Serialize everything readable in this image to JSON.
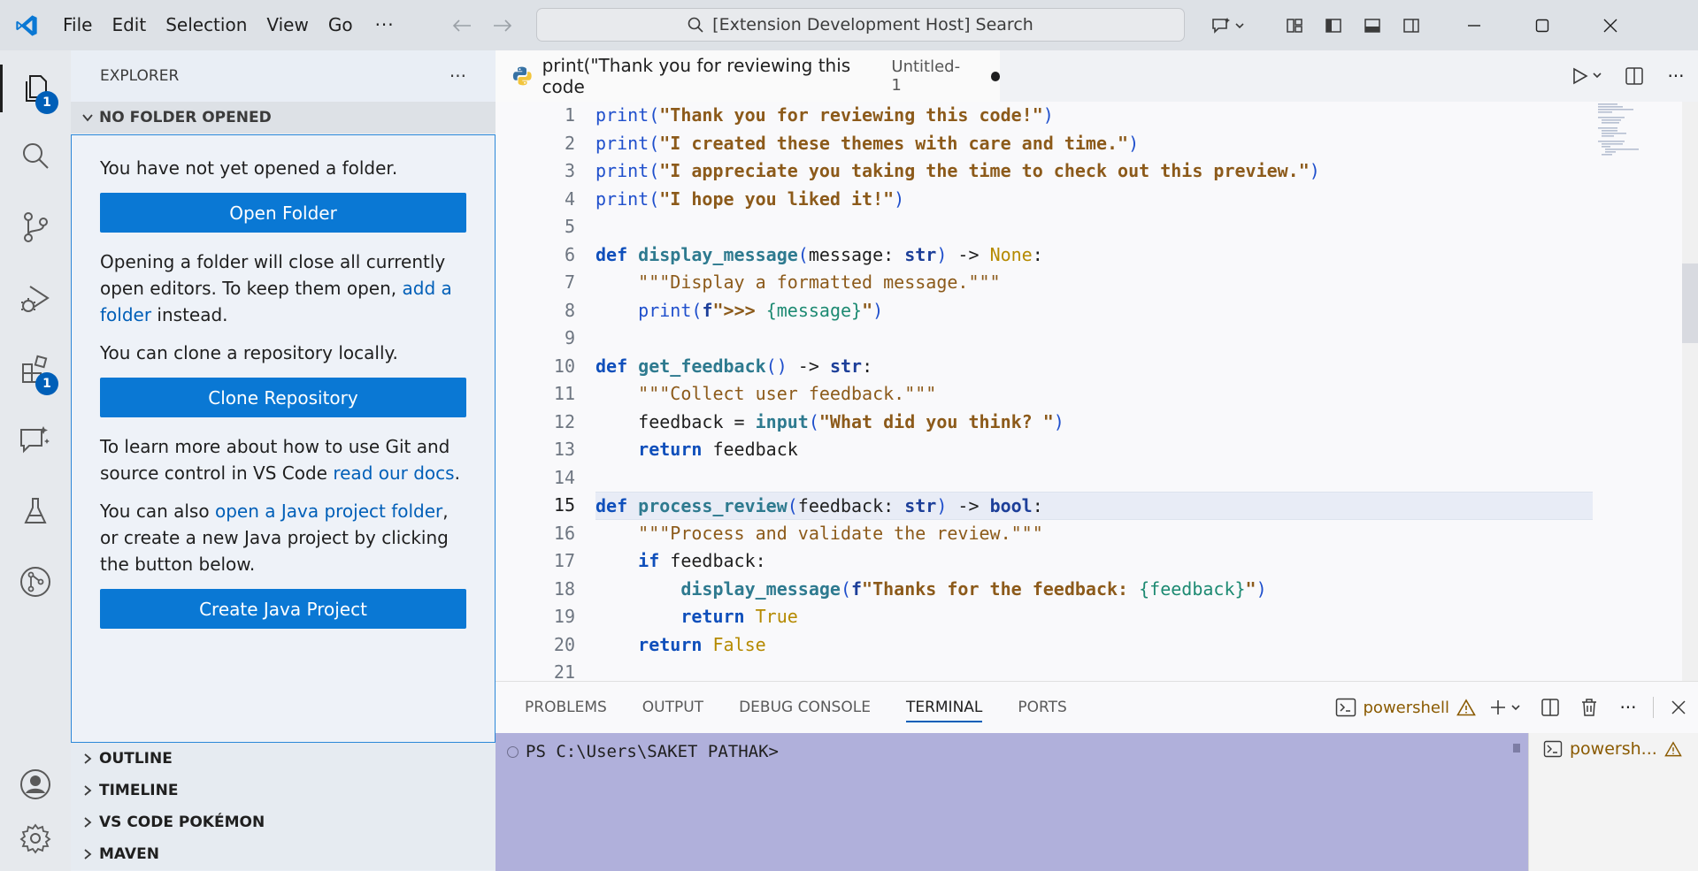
{
  "titlebar": {
    "menu": [
      "File",
      "Edit",
      "Selection",
      "View",
      "Go"
    ],
    "more": "···",
    "search": "[Extension Development Host] Search"
  },
  "activity": {
    "explorer_badge": "1",
    "extensions_badge": "1"
  },
  "sidebar": {
    "title": "EXPLORER",
    "more": "···",
    "section": "NO FOLDER OPENED",
    "p1": "You have not yet opened a folder.",
    "open_folder": "Open Folder",
    "p2_a": "Opening a folder will close all currently open editors. To keep them open, ",
    "p2_link": "add a folder",
    "p2_b": " instead.",
    "p3": "You can clone a repository locally.",
    "clone": "Clone Repository",
    "p4_a": "To learn more about how to use Git and source control in VS Code ",
    "p4_link": "read our docs",
    "p4_b": ".",
    "p5_a": "You can also ",
    "p5_link": "open a Java project folder",
    "p5_b": ", or create a new Java project by clicking the button below.",
    "create_java": "Create Java Project",
    "collapsed": [
      "OUTLINE",
      "TIMELINE",
      "VS CODE POKÉMON",
      "MAVEN"
    ]
  },
  "editor": {
    "tab_title": "print(\"Thank you for reviewing this code",
    "tab_desc": "Untitled-1",
    "active_line": "15",
    "line_numbers": [
      "1",
      "2",
      "3",
      "4",
      "5",
      "6",
      "7",
      "8",
      "9",
      "10",
      "11",
      "12",
      "13",
      "14",
      "15",
      "16",
      "17",
      "18",
      "19",
      "20",
      "21"
    ]
  },
  "panel": {
    "tabs": [
      "PROBLEMS",
      "OUTPUT",
      "DEBUG CONSOLE",
      "TERMINAL",
      "PORTS"
    ],
    "active_tab": "TERMINAL",
    "shell": "powershell",
    "prompt": "PS C:\\Users\\SAKET PATHAK>",
    "term_item": "powersh..."
  },
  "colors": {
    "accent": "#005fb8",
    "button": "#0a78d4",
    "terminal_bg": "#b0b0db"
  }
}
